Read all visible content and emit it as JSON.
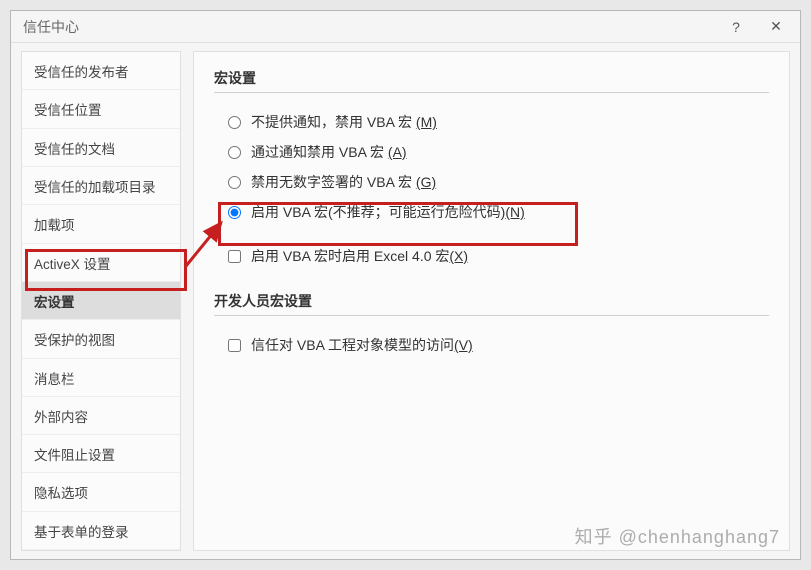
{
  "titlebar": {
    "title": "信任中心",
    "help": "?",
    "close": "✕"
  },
  "sidebar": {
    "items": [
      {
        "label": "受信任的发布者"
      },
      {
        "label": "受信任位置"
      },
      {
        "label": "受信任的文档"
      },
      {
        "label": "受信任的加载项目录"
      },
      {
        "label": "加载项"
      },
      {
        "label": "ActiveX 设置"
      },
      {
        "label": "宏设置"
      },
      {
        "label": "受保护的视图"
      },
      {
        "label": "消息栏"
      },
      {
        "label": "外部内容"
      },
      {
        "label": "文件阻止设置"
      },
      {
        "label": "隐私选项"
      },
      {
        "label": "基于表单的登录"
      }
    ],
    "selected_index": 6
  },
  "content": {
    "section1_title": "宏设置",
    "radios": [
      {
        "label": "不提供通知，禁用 VBA 宏 ",
        "mnemonic": "(M)"
      },
      {
        "label": "通过通知禁用 VBA 宏 ",
        "mnemonic": "(A)"
      },
      {
        "label": "禁用无数字签署的 VBA 宏 ",
        "mnemonic": "(G)"
      },
      {
        "label": "启用 VBA 宏(不推荐；可能运行危险代码)",
        "mnemonic": "(N)"
      }
    ],
    "radio_selected_index": 3,
    "checkbox1_label": "启用 VBA 宏时启用 Excel 4.0 宏",
    "checkbox1_mnemonic": "(X)",
    "section2_title": "开发人员宏设置",
    "checkbox2_label": "信任对 VBA 工程对象模型的访问",
    "checkbox2_mnemonic": "(V)"
  },
  "watermark": "知乎 @chenhanghang7"
}
